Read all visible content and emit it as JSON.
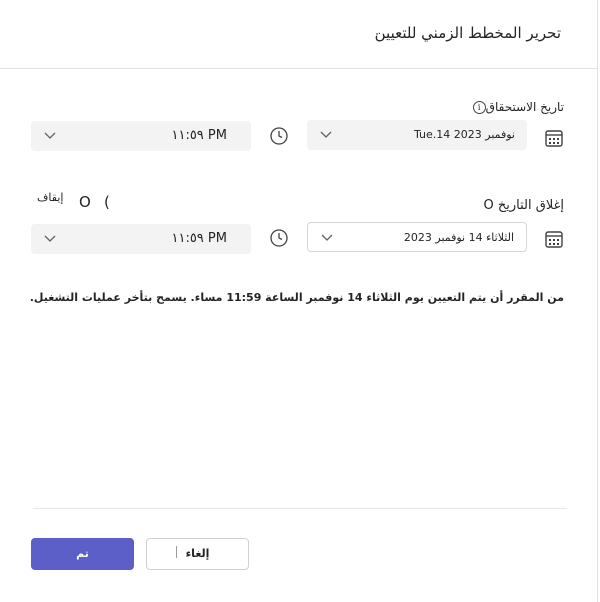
{
  "dialog": {
    "title": "تحرير المخطط الزمني للتعيين"
  },
  "due_date": {
    "label": "تاريخ الاستحقاق",
    "info_icon_glyph": "i",
    "date_value": "Tue.14 نوفمبر 2023",
    "time_value": "١١:٥٩ PM"
  },
  "close_date": {
    "label": "إغلاق التاريخ O",
    "toggle_state_label": "إيقاف",
    "toggle_paren": "(",
    "toggle_ring": "O",
    "date_value": "الثلاثاء 14 نوفمبر 2023",
    "time_value": "١١:٥٩ PM"
  },
  "summary": "من المقرر أن يتم التعيين يوم الثلاثاء 14 نوفمبر الساعة 11:59 مساء. يسمح بتأخر عمليات التشغيل.",
  "footer": {
    "done_label": "تم",
    "cancel_label": "إلغاء"
  },
  "colors": {
    "primary": "#5b5fc7",
    "field_bg": "#f3f3f3",
    "border": "#e1e1e1",
    "text": "#242424"
  },
  "icons": {
    "chevron": "chevron-down-icon",
    "clock": "clock-icon",
    "calendar": "calendar-icon",
    "info": "info-icon"
  }
}
